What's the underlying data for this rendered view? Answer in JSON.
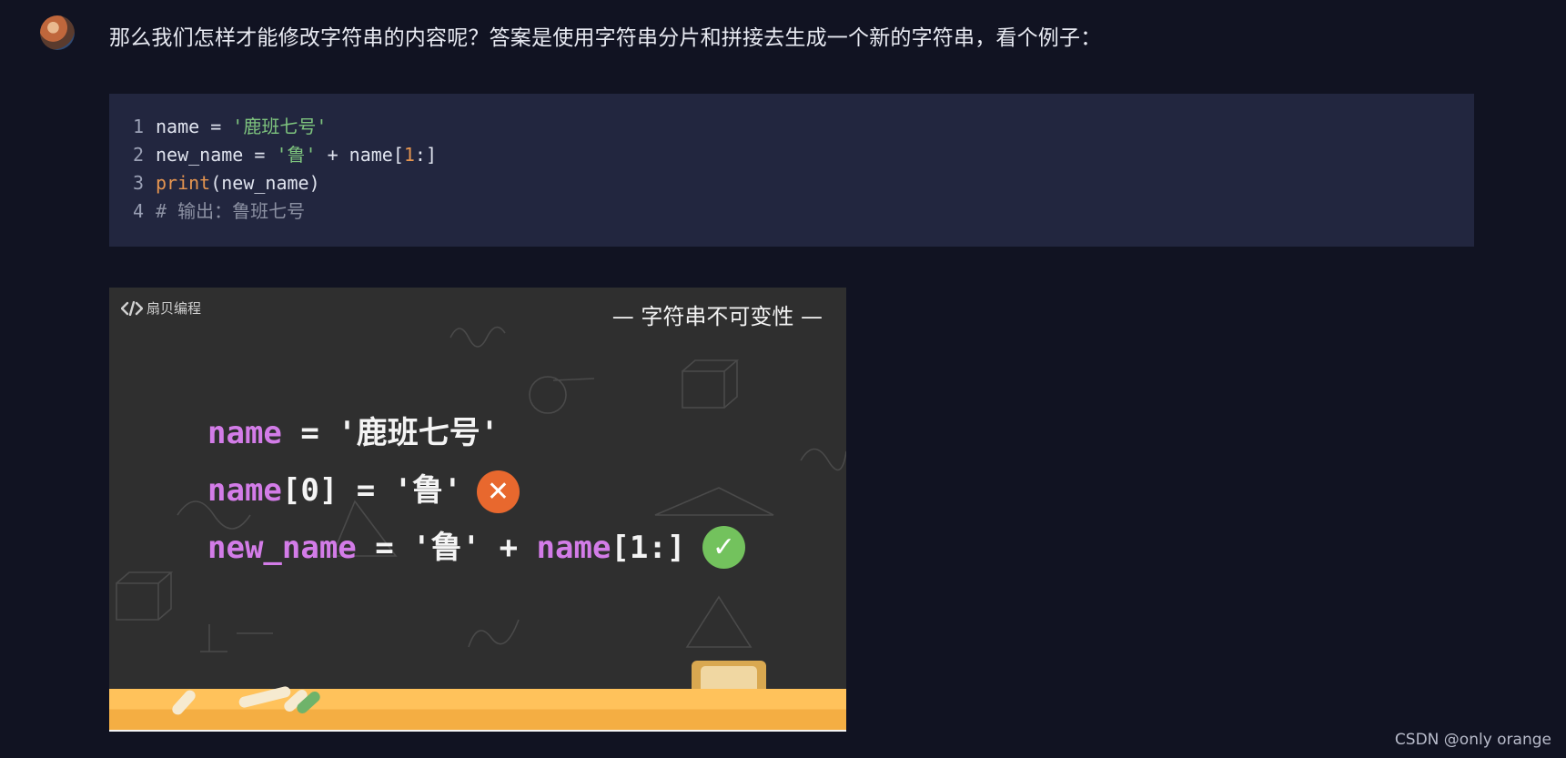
{
  "post": {
    "intro": "那么我们怎样才能修改字符串的内容呢？答案是使用字符串分片和拼接去生成一个新的字符串，看个例子："
  },
  "code": {
    "lines": [
      {
        "num": "1",
        "parts": [
          "name = ",
          "'鹿班七号'"
        ]
      },
      {
        "num": "2",
        "parts": [
          "new_name = ",
          "'鲁'",
          " + name[",
          "1",
          ":]"
        ]
      },
      {
        "num": "3",
        "parts": [
          "print",
          "(new_name)"
        ]
      },
      {
        "num": "4",
        "parts": [
          "# 输出：鲁班七号"
        ]
      }
    ]
  },
  "image": {
    "logo": "扇贝编程",
    "title": "— 字符串不可变性 —",
    "lines": [
      {
        "kw": "name",
        "rest": " = '鹿班七号'"
      },
      {
        "kw": "name",
        "rest": "[0] = '鲁'"
      },
      {
        "kw": "new_name",
        "rest": " = '鲁' + ",
        "kw2": "name",
        "rest2": "[1:]"
      }
    ],
    "cross_glyph": "✕",
    "check_glyph": "✓",
    "colors": {
      "keyword": "#d37ce8",
      "cross": "#e8682e",
      "check": "#73c25d",
      "shelf": "#ffc25b"
    }
  },
  "watermark": "CSDN @only orange"
}
